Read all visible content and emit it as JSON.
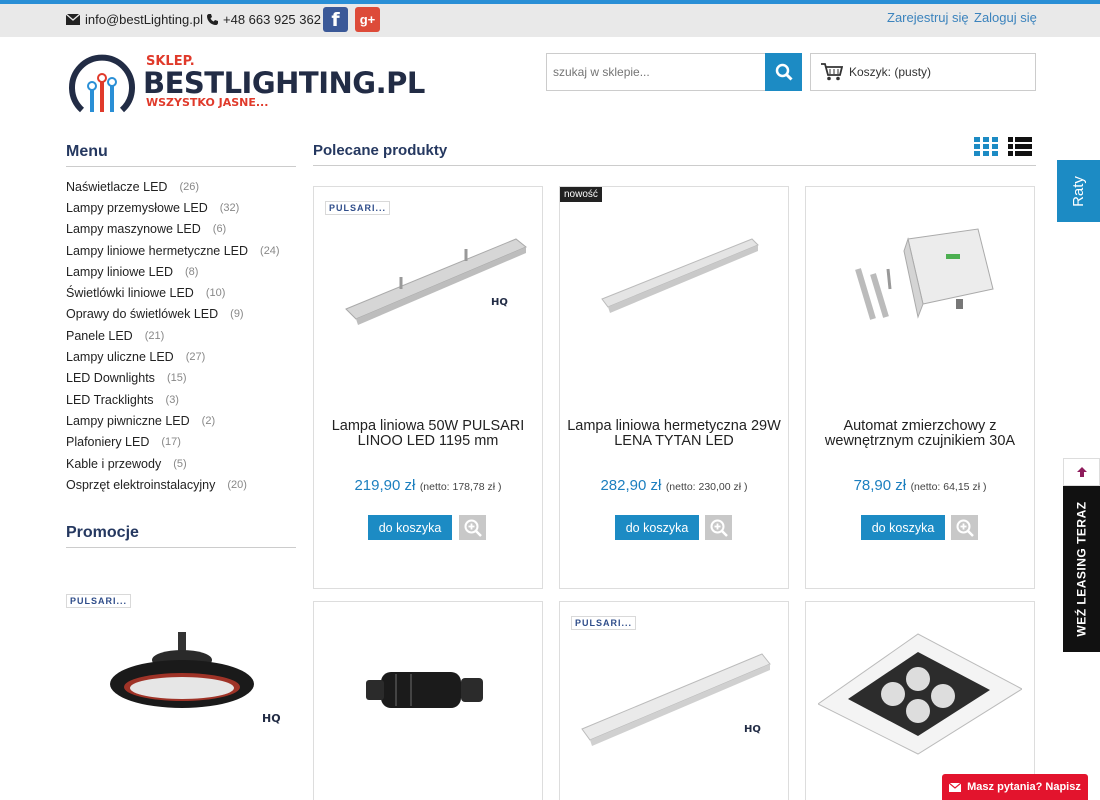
{
  "topbar": {
    "email": "info@bestLighting.pl",
    "phone": "+48 663 925 362",
    "register": "Zarejestruj się",
    "login": "Zaloguj się",
    "facebook_letter": "f",
    "gplus_letter": "g+"
  },
  "logo": {
    "top": "SKLEP.",
    "brand": "BESTLIGHTING.PL",
    "bottom": "WSZYSTKO JASNE..."
  },
  "search": {
    "placeholder": "szukaj w sklepie..."
  },
  "cart": {
    "label": "Koszyk: (pusty)"
  },
  "sidebar": {
    "menu_title": "Menu",
    "items": [
      {
        "label": "Naświetlacze LED",
        "count": "(26)"
      },
      {
        "label": "Lampy przemysłowe LED",
        "count": "(32)"
      },
      {
        "label": "Lampy maszynowe LED",
        "count": "(6)"
      },
      {
        "label": "Lampy liniowe hermetyczne LED",
        "count": "(24)"
      },
      {
        "label": "Lampy liniowe LED",
        "count": "(8)"
      },
      {
        "label": "Świetlówki liniowe LED",
        "count": "(10)"
      },
      {
        "label": "Oprawy do świetlówek LED",
        "count": "(9)"
      },
      {
        "label": "Panele LED",
        "count": "(21)"
      },
      {
        "label": "Lampy uliczne LED",
        "count": "(27)"
      },
      {
        "label": "LED Downlights",
        "count": "(15)"
      },
      {
        "label": "LED Tracklights",
        "count": "(3)"
      },
      {
        "label": "Lampy piwniczne LED",
        "count": "(2)"
      },
      {
        "label": "Plafoniery LED",
        "count": "(17)"
      },
      {
        "label": "Kable i przewody",
        "count": "(5)"
      },
      {
        "label": "Osprzęt elektroinstalacyjny",
        "count": "(20)"
      }
    ],
    "promo_title": "Promocje",
    "promo_brand": "PULSARI..."
  },
  "main": {
    "title": "Polecane produkty",
    "products": [
      {
        "name": "Lampa liniowa 50W PULSARI LINOO LED 1195 mm",
        "price": "219,90 zł",
        "netto": "(netto: 178,78 zł )",
        "brand": "PULSARI...",
        "badge": ""
      },
      {
        "name": "Lampa liniowa hermetyczna 29W LENA TYTAN LED",
        "price": "282,90 zł",
        "netto": "(netto: 230,00 zł )",
        "brand": "",
        "badge": "nowość"
      },
      {
        "name": "Automat zmierzchowy z wewnętrznym czujnikiem 30A",
        "price": "78,90 zł",
        "netto": "(netto: 64,15 zł )",
        "brand": "",
        "badge": ""
      },
      {
        "brand": "",
        "badge": ""
      },
      {
        "brand": "PULSARI...",
        "badge": ""
      },
      {
        "brand": "",
        "badge": ""
      }
    ],
    "add_to_cart": "do koszyka"
  },
  "widgets": {
    "raty": "Raty",
    "leasing": "WEŹ LEASING TERAZ",
    "ask": "Masz pytania? Napisz"
  },
  "colors": {
    "accent": "#1c8bc4",
    "heading": "#253860",
    "alert": "#e3142d"
  }
}
